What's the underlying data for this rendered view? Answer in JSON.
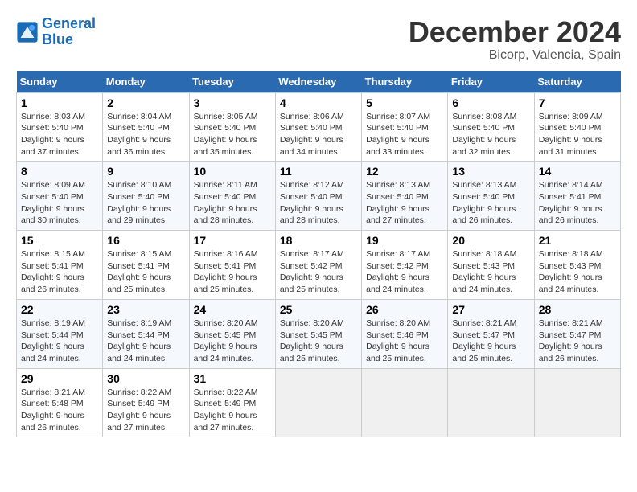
{
  "header": {
    "logo_line1": "General",
    "logo_line2": "Blue",
    "month": "December 2024",
    "location": "Bicorp, Valencia, Spain"
  },
  "weekdays": [
    "Sunday",
    "Monday",
    "Tuesday",
    "Wednesday",
    "Thursday",
    "Friday",
    "Saturday"
  ],
  "weeks": [
    [
      {
        "day": "1",
        "info": "Sunrise: 8:03 AM\nSunset: 5:40 PM\nDaylight: 9 hours and 37 minutes."
      },
      {
        "day": "2",
        "info": "Sunrise: 8:04 AM\nSunset: 5:40 PM\nDaylight: 9 hours and 36 minutes."
      },
      {
        "day": "3",
        "info": "Sunrise: 8:05 AM\nSunset: 5:40 PM\nDaylight: 9 hours and 35 minutes."
      },
      {
        "day": "4",
        "info": "Sunrise: 8:06 AM\nSunset: 5:40 PM\nDaylight: 9 hours and 34 minutes."
      },
      {
        "day": "5",
        "info": "Sunrise: 8:07 AM\nSunset: 5:40 PM\nDaylight: 9 hours and 33 minutes."
      },
      {
        "day": "6",
        "info": "Sunrise: 8:08 AM\nSunset: 5:40 PM\nDaylight: 9 hours and 32 minutes."
      },
      {
        "day": "7",
        "info": "Sunrise: 8:09 AM\nSunset: 5:40 PM\nDaylight: 9 hours and 31 minutes."
      }
    ],
    [
      {
        "day": "8",
        "info": "Sunrise: 8:09 AM\nSunset: 5:40 PM\nDaylight: 9 hours and 30 minutes."
      },
      {
        "day": "9",
        "info": "Sunrise: 8:10 AM\nSunset: 5:40 PM\nDaylight: 9 hours and 29 minutes."
      },
      {
        "day": "10",
        "info": "Sunrise: 8:11 AM\nSunset: 5:40 PM\nDaylight: 9 hours and 28 minutes."
      },
      {
        "day": "11",
        "info": "Sunrise: 8:12 AM\nSunset: 5:40 PM\nDaylight: 9 hours and 28 minutes."
      },
      {
        "day": "12",
        "info": "Sunrise: 8:13 AM\nSunset: 5:40 PM\nDaylight: 9 hours and 27 minutes."
      },
      {
        "day": "13",
        "info": "Sunrise: 8:13 AM\nSunset: 5:40 PM\nDaylight: 9 hours and 26 minutes."
      },
      {
        "day": "14",
        "info": "Sunrise: 8:14 AM\nSunset: 5:41 PM\nDaylight: 9 hours and 26 minutes."
      }
    ],
    [
      {
        "day": "15",
        "info": "Sunrise: 8:15 AM\nSunset: 5:41 PM\nDaylight: 9 hours and 26 minutes."
      },
      {
        "day": "16",
        "info": "Sunrise: 8:15 AM\nSunset: 5:41 PM\nDaylight: 9 hours and 25 minutes."
      },
      {
        "day": "17",
        "info": "Sunrise: 8:16 AM\nSunset: 5:41 PM\nDaylight: 9 hours and 25 minutes."
      },
      {
        "day": "18",
        "info": "Sunrise: 8:17 AM\nSunset: 5:42 PM\nDaylight: 9 hours and 25 minutes."
      },
      {
        "day": "19",
        "info": "Sunrise: 8:17 AM\nSunset: 5:42 PM\nDaylight: 9 hours and 24 minutes."
      },
      {
        "day": "20",
        "info": "Sunrise: 8:18 AM\nSunset: 5:43 PM\nDaylight: 9 hours and 24 minutes."
      },
      {
        "day": "21",
        "info": "Sunrise: 8:18 AM\nSunset: 5:43 PM\nDaylight: 9 hours and 24 minutes."
      }
    ],
    [
      {
        "day": "22",
        "info": "Sunrise: 8:19 AM\nSunset: 5:44 PM\nDaylight: 9 hours and 24 minutes."
      },
      {
        "day": "23",
        "info": "Sunrise: 8:19 AM\nSunset: 5:44 PM\nDaylight: 9 hours and 24 minutes."
      },
      {
        "day": "24",
        "info": "Sunrise: 8:20 AM\nSunset: 5:45 PM\nDaylight: 9 hours and 24 minutes."
      },
      {
        "day": "25",
        "info": "Sunrise: 8:20 AM\nSunset: 5:45 PM\nDaylight: 9 hours and 25 minutes."
      },
      {
        "day": "26",
        "info": "Sunrise: 8:20 AM\nSunset: 5:46 PM\nDaylight: 9 hours and 25 minutes."
      },
      {
        "day": "27",
        "info": "Sunrise: 8:21 AM\nSunset: 5:47 PM\nDaylight: 9 hours and 25 minutes."
      },
      {
        "day": "28",
        "info": "Sunrise: 8:21 AM\nSunset: 5:47 PM\nDaylight: 9 hours and 26 minutes."
      }
    ],
    [
      {
        "day": "29",
        "info": "Sunrise: 8:21 AM\nSunset: 5:48 PM\nDaylight: 9 hours and 26 minutes."
      },
      {
        "day": "30",
        "info": "Sunrise: 8:22 AM\nSunset: 5:49 PM\nDaylight: 9 hours and 27 minutes."
      },
      {
        "day": "31",
        "info": "Sunrise: 8:22 AM\nSunset: 5:49 PM\nDaylight: 9 hours and 27 minutes."
      },
      null,
      null,
      null,
      null
    ]
  ]
}
